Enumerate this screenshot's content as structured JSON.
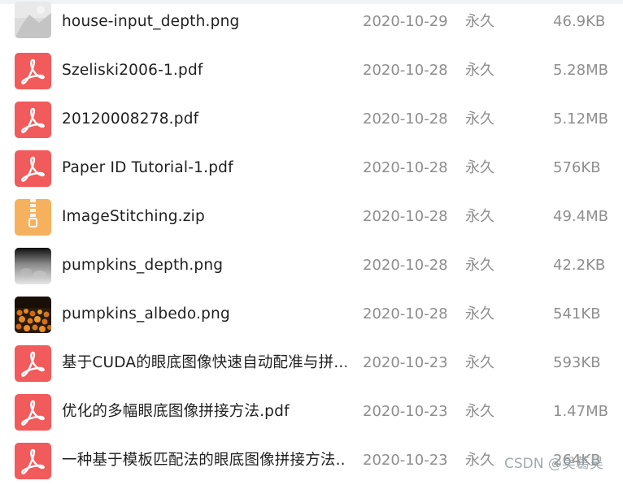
{
  "files": [
    {
      "name": "house-input_depth.png",
      "date": "2020-10-29",
      "expiry": "永久",
      "size": "46.9KB",
      "icon": "image-thumbnail-icon"
    },
    {
      "name": "Szeliski2006-1.pdf",
      "date": "2020-10-28",
      "expiry": "永久",
      "size": "5.28MB",
      "icon": "pdf-icon"
    },
    {
      "name": "20120008278.pdf",
      "date": "2020-10-28",
      "expiry": "永久",
      "size": "5.12MB",
      "icon": "pdf-icon"
    },
    {
      "name": "Paper ID Tutorial-1.pdf",
      "date": "2020-10-28",
      "expiry": "永久",
      "size": "576KB",
      "icon": "pdf-icon"
    },
    {
      "name": "ImageStitching.zip",
      "date": "2020-10-28",
      "expiry": "永久",
      "size": "49.4MB",
      "icon": "zip-icon"
    },
    {
      "name": "pumpkins_depth.png",
      "date": "2020-10-28",
      "expiry": "永久",
      "size": "42.2KB",
      "icon": "image-thumbnail-icon"
    },
    {
      "name": "pumpkins_albedo.png",
      "date": "2020-10-28",
      "expiry": "永久",
      "size": "541KB",
      "icon": "image-thumbnail-icon"
    },
    {
      "name": "基于CUDA的眼底图像快速自动配准与拼...",
      "date": "2020-10-23",
      "expiry": "永久",
      "size": "593KB",
      "icon": "pdf-icon"
    },
    {
      "name": "优化的多幅眼底图像拼接方法.pdf",
      "date": "2020-10-23",
      "expiry": "永久",
      "size": "1.47MB",
      "icon": "pdf-icon"
    },
    {
      "name": "一种基于模板匹配法的眼底图像拼接方法...",
      "date": "2020-10-23",
      "expiry": "永久",
      "size": "264KB",
      "icon": "pdf-icon"
    }
  ],
  "watermark": "CSDN @吴葛昊",
  "colors": {
    "pdf_red": "#f15b5b",
    "zip_orange": "#f5b15e",
    "text_primary": "#1f1f1f",
    "text_secondary": "#8e8e8e"
  }
}
